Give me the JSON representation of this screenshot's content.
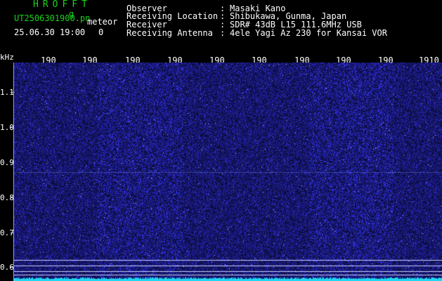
{
  "header": {
    "brand": "HROFFT",
    "file_name": "UT2506301900.pn",
    "file_suffix": "g",
    "file_tag": "meteor",
    "timestamp": "25.06.30 19:00",
    "count": "0"
  },
  "metadata": [
    {
      "label": "Observer",
      "value": "Masaki Kano"
    },
    {
      "label": "Receiving Location",
      "value": "Shibukawa, Gunma, Japan"
    },
    {
      "label": "Receiver",
      "value": "SDR# 43dB L15 111.6MHz USB"
    },
    {
      "label": "Receiving Antenna",
      "value": "4ele Yagi Az 230 for Kansai VOR"
    }
  ],
  "axis": {
    "unit": "kHz",
    "x_ticks": [
      "190",
      "190",
      "190",
      "190",
      "190",
      "190",
      "190",
      "190",
      "190",
      "1910"
    ],
    "y_ticks": [
      "1.1",
      "1.0",
      "0.9",
      "0.8",
      "0.7",
      "0.6"
    ]
  },
  "colors": {
    "background": "#000000",
    "noise": "#2a2ab5",
    "trace": "#1fd7f0",
    "band_line": "#c8d0ff",
    "brand": "#19d219"
  }
}
